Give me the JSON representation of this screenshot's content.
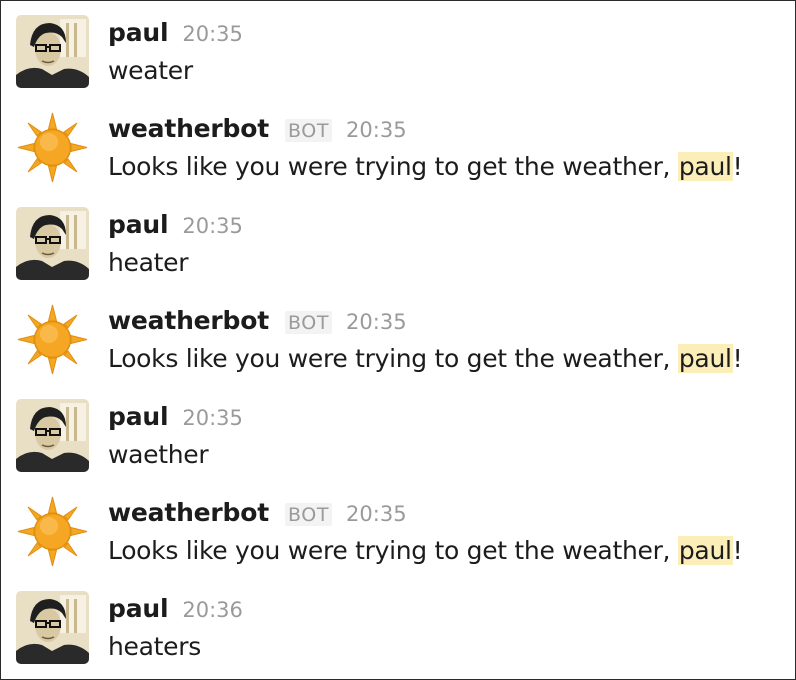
{
  "messages": [
    {
      "sender": "paul",
      "is_bot": false,
      "time": "20:35",
      "text": "weater",
      "avatar_icon": "user-photo-avatar"
    },
    {
      "sender": "weatherbot",
      "is_bot": true,
      "badge": "BOT",
      "time": "20:35",
      "text_before": "Looks like you were trying to get the weather, ",
      "mention": "paul",
      "text_after": "!",
      "avatar_icon": "sun-icon"
    },
    {
      "sender": "paul",
      "is_bot": false,
      "time": "20:35",
      "text": "heater",
      "avatar_icon": "user-photo-avatar"
    },
    {
      "sender": "weatherbot",
      "is_bot": true,
      "badge": "BOT",
      "time": "20:35",
      "text_before": "Looks like you were trying to get the weather, ",
      "mention": "paul",
      "text_after": "!",
      "avatar_icon": "sun-icon"
    },
    {
      "sender": "paul",
      "is_bot": false,
      "time": "20:35",
      "text": "waether",
      "avatar_icon": "user-photo-avatar"
    },
    {
      "sender": "weatherbot",
      "is_bot": true,
      "badge": "BOT",
      "time": "20:35",
      "text_before": "Looks like you were trying to get the weather, ",
      "mention": "paul",
      "text_after": "!",
      "avatar_icon": "sun-icon"
    },
    {
      "sender": "paul",
      "is_bot": false,
      "time": "20:36",
      "text": "heaters",
      "avatar_icon": "user-photo-avatar"
    }
  ],
  "colors": {
    "mention_highlight": "#fbeeb8",
    "sun_fill": "#f5a623",
    "text_primary": "#1d1c1d",
    "text_muted": "#9a9a9a"
  }
}
